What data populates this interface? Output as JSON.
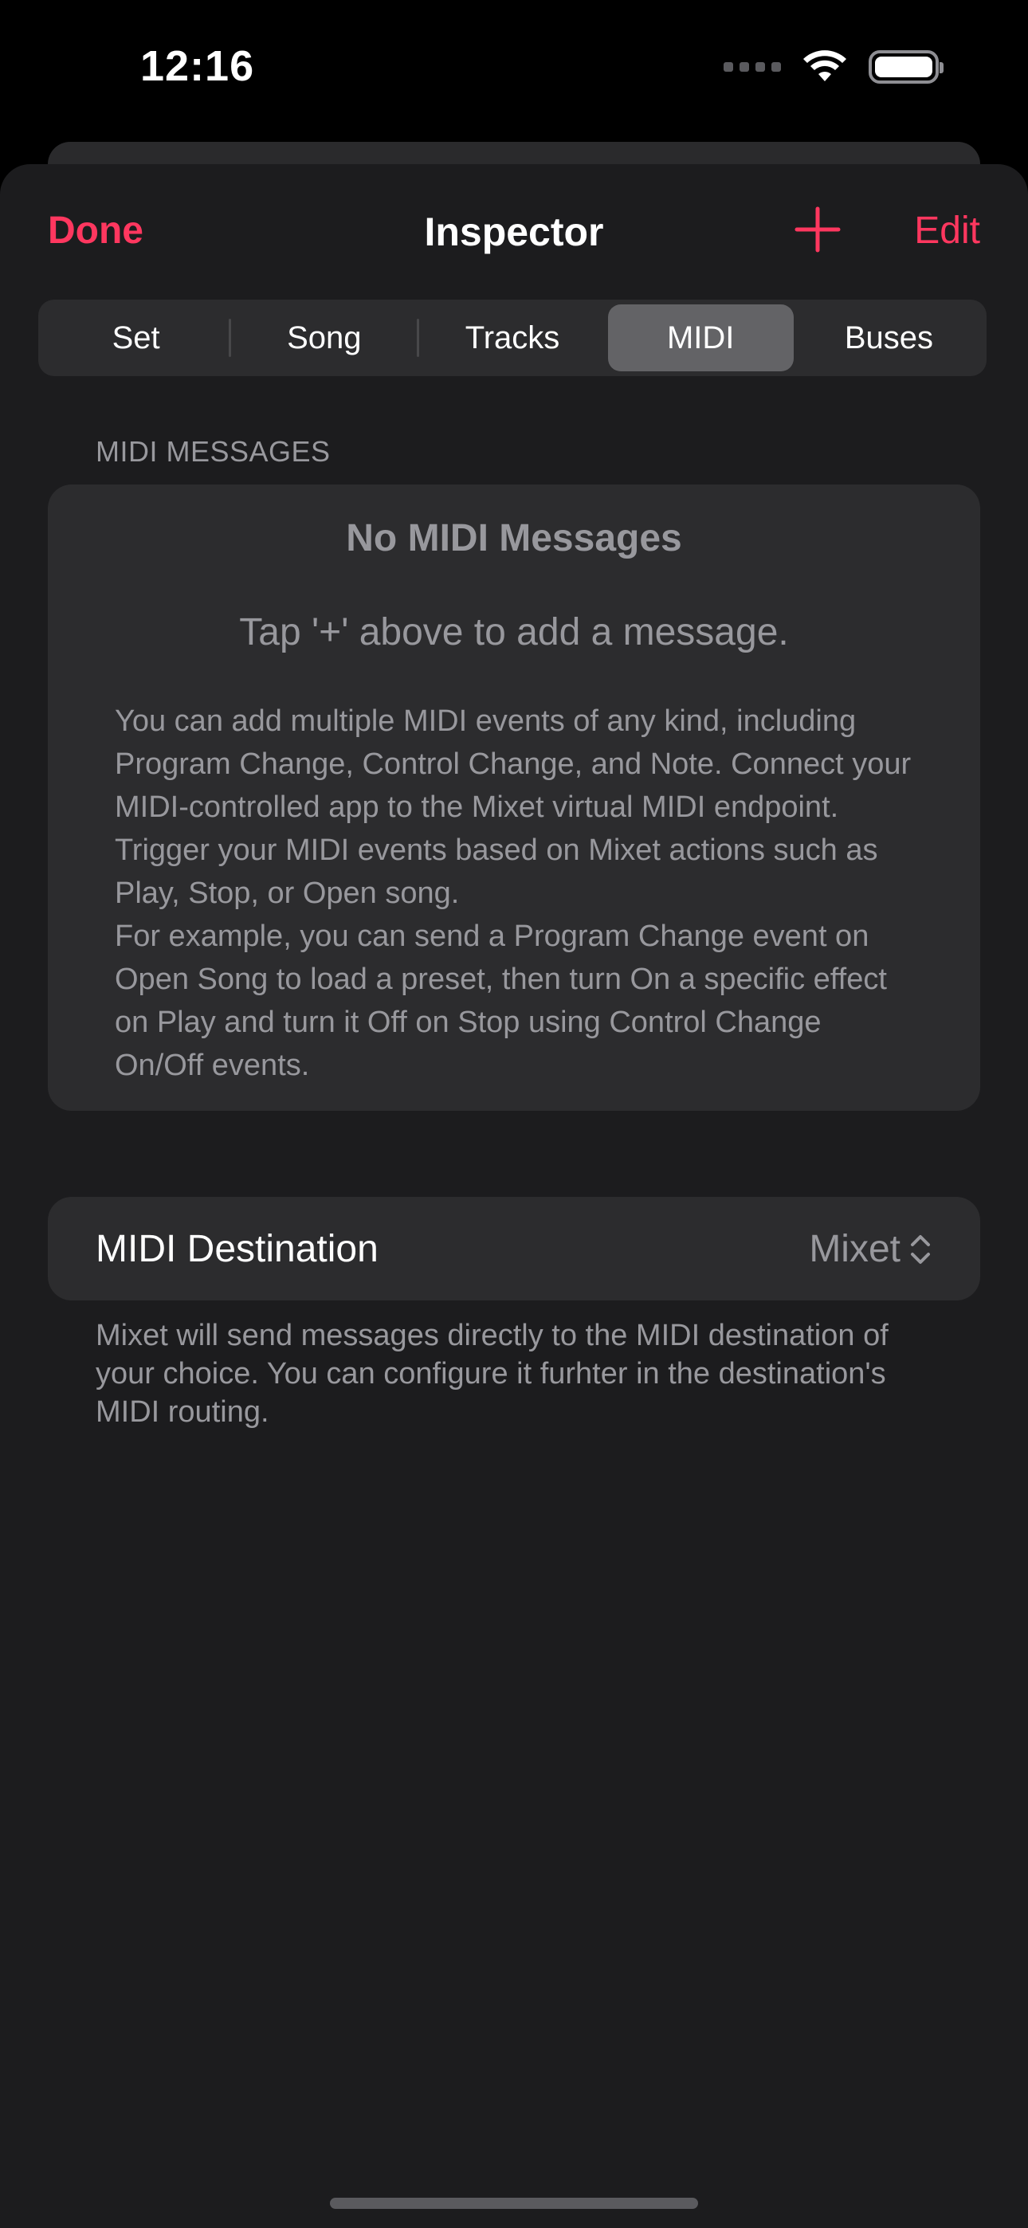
{
  "status_bar": {
    "time": "12:16",
    "icons": [
      "cellular-signal-icon",
      "wifi-icon",
      "battery-icon"
    ]
  },
  "nav": {
    "done_label": "Done",
    "title": "Inspector",
    "add_icon": "plus-icon",
    "edit_label": "Edit"
  },
  "tabs": [
    {
      "label": "Set",
      "active": false
    },
    {
      "label": "Song",
      "active": false
    },
    {
      "label": "Tracks",
      "active": false
    },
    {
      "label": "MIDI",
      "active": true
    },
    {
      "label": "Buses",
      "active": false
    }
  ],
  "midi_messages": {
    "section_header": "MIDI MESSAGES",
    "empty_title": "No MIDI Messages",
    "empty_subtitle": "Tap '+' above to add a message.",
    "description": "You can add multiple MIDI events of any kind, including Program Change, Control Change, and Note. Connect your MIDI-controlled app to the Mixet virtual MIDI endpoint. Trigger your MIDI events based on Mixet actions such as Play, Stop, or Open song.\nFor example, you can send a Program Change event on Open Song to load a preset, then turn On a specific effect on Play and turn it Off on Stop using Control Change On/Off events."
  },
  "midi_destination": {
    "label": "MIDI Destination",
    "value": "Mixet",
    "chevron_icon": "chevron-up-down-icon",
    "footer": "Mixet will send messages directly to the MIDI destination of your choice. You can configure it furhter in the destination's MIDI routing."
  },
  "colors": {
    "accent": "#ff375f",
    "sheet_background": "#1c1c1e",
    "card_background": "#2c2c2e",
    "secondary_text": "#98989d",
    "active_segment": "#636366"
  }
}
